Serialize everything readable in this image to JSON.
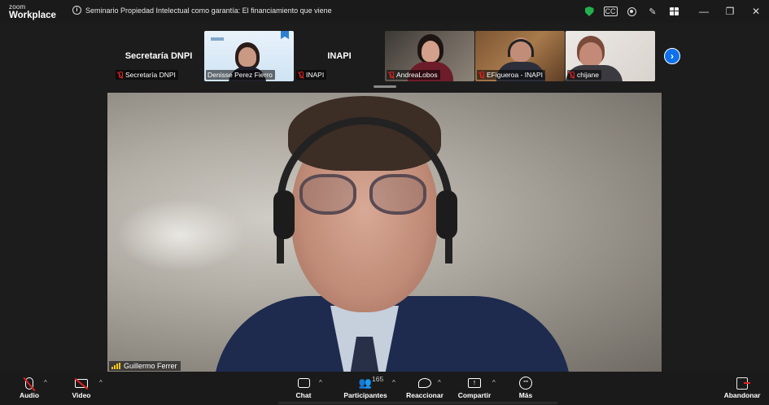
{
  "titlebar": {
    "logo_small": "zoom",
    "logo_big": "Workplace",
    "meeting_title": "Seminario Propiedad Intelectual como garantía: El financiamiento que viene"
  },
  "filmstrip": {
    "tiles": [
      {
        "display_name": "Secretaría DNPI",
        "tag": "Secretaría DNPI",
        "video": false
      },
      {
        "display_name": "",
        "tag": "Denisse Perez Fierro",
        "video": true
      },
      {
        "display_name": "INAPI",
        "tag": "INAPI",
        "video": false
      },
      {
        "display_name": "",
        "tag": "AndreaLobos",
        "video": true
      },
      {
        "display_name": "",
        "tag": "EFigueroa - INAPI",
        "video": true
      },
      {
        "display_name": "",
        "tag": "chijane",
        "video": true
      }
    ]
  },
  "main_video": {
    "speaker_name": "Guillermo Ferrer"
  },
  "toolbar": {
    "audio_label": "Audio",
    "video_label": "Video",
    "chat_label": "Chat",
    "participants_label": "Participantes",
    "participants_count": "165",
    "react_label": "Reaccionar",
    "share_label": "Compartir",
    "more_label": "Más",
    "leave_label": "Abandonar"
  },
  "colors": {
    "accent": "#0e71eb",
    "mute_red": "#e02020",
    "shield_green": "#23b14d"
  },
  "icons": [
    "info-icon",
    "shield-icon",
    "captions-icon",
    "record-icon",
    "annotate-icon",
    "gallery-view-icon",
    "minimize-icon",
    "restore-icon",
    "close-icon",
    "mic-muted-icon",
    "video-off-icon",
    "chat-icon",
    "participants-icon",
    "reactions-icon",
    "share-screen-icon",
    "more-icon",
    "leave-icon"
  ]
}
